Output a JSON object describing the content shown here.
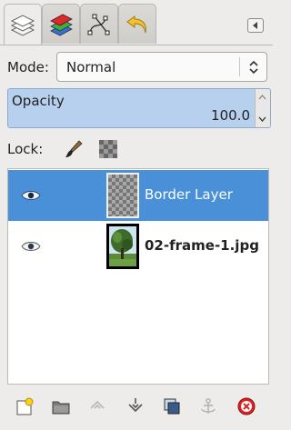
{
  "tabs": [
    {
      "name": "layers-icon",
      "active": true
    },
    {
      "name": "channels-icon",
      "active": false
    },
    {
      "name": "paths-icon",
      "active": false
    },
    {
      "name": "undo-history-icon",
      "active": false
    }
  ],
  "mode": {
    "label": "Mode:",
    "value": "Normal"
  },
  "opacity": {
    "label": "Opacity",
    "value": "100.0",
    "fraction": 1.0
  },
  "lock": {
    "label": "Lock:"
  },
  "layers": [
    {
      "name": "Border Layer",
      "visible": true,
      "selected": true,
      "thumbnail": "checker"
    },
    {
      "name": "02-frame-1.jpg",
      "visible": true,
      "selected": false,
      "thumbnail": "photo"
    }
  ],
  "bottom_buttons": [
    "new-layer-icon",
    "new-layer-group-icon",
    "raise-layer-icon",
    "lower-layer-icon",
    "duplicate-layer-icon",
    "anchor-layer-icon",
    "delete-layer-icon"
  ]
}
